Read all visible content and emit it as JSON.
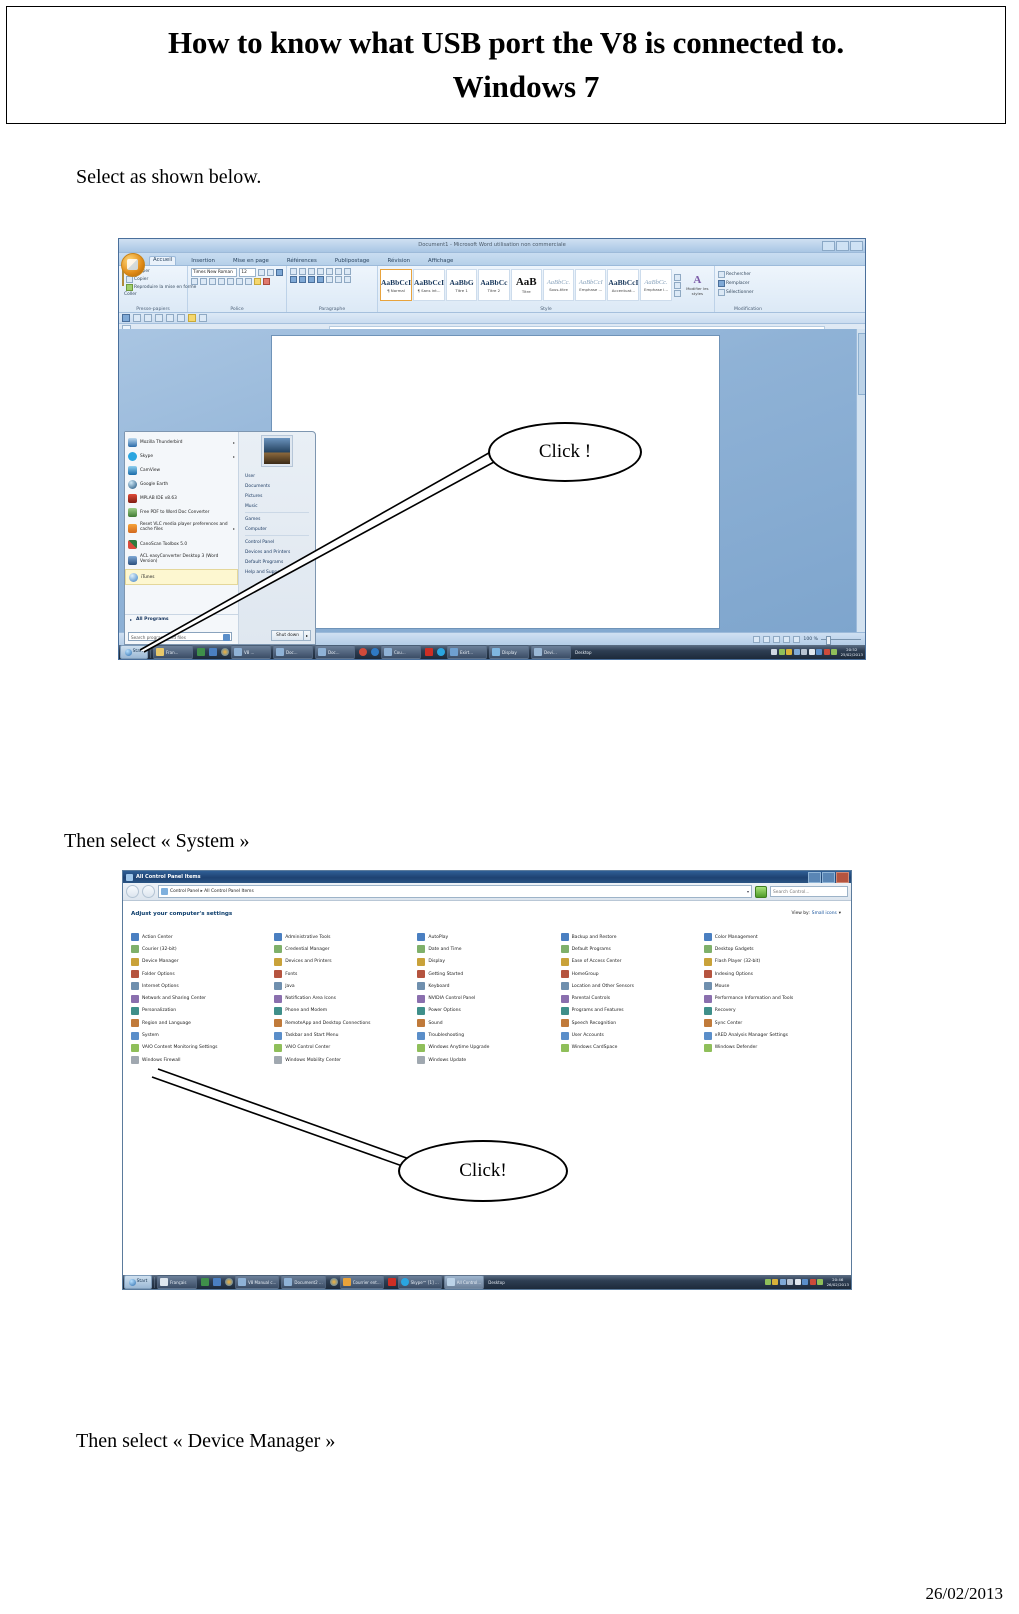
{
  "document": {
    "title_line1": "How to know what USB port the V8 is connected to.",
    "title_line2": "Windows 7",
    "caption_select": "Select as shown below.",
    "caption_system": "Then select « System »",
    "caption_devmgr": "Then select « Device Manager »",
    "footer_date": "26/02/2013"
  },
  "callouts": {
    "first": "Click !",
    "second": "Click!"
  },
  "word_screenshot": {
    "window_title": "Document1  -  Microsoft Word utilisation non commerciale",
    "tabs": [
      "Accueil",
      "Insertion",
      "Mise en page",
      "Références",
      "Publipostage",
      "Révision",
      "Affichage"
    ],
    "active_tab": "Accueil",
    "groups": {
      "clipboard": {
        "label": "Presse-papiers",
        "paste": "Coller",
        "cut": "Couper",
        "copy": "Copier",
        "format_painter": "Reproduire la mise en forme"
      },
      "font": {
        "label": "Police",
        "font_name": "Times New Roman",
        "font_size": "12"
      },
      "paragraph": {
        "label": "Paragraphe"
      },
      "styles": {
        "label": "Style",
        "items": [
          {
            "sample": "AaBbCcI",
            "name": "¶ Normal"
          },
          {
            "sample": "AaBbCcI",
            "name": "¶ Sans int..."
          },
          {
            "sample": "AaBbG",
            "name": "Titre 1"
          },
          {
            "sample": "AaBbCc",
            "name": "Titre 2"
          },
          {
            "sample": "AaB",
            "name": "Titre"
          },
          {
            "sample": "AaBbCc.",
            "name": "Sous-titre"
          },
          {
            "sample": "AaBbCcI",
            "name": "Emphase ..."
          },
          {
            "sample": "AaBbCcI",
            "name": "Accentuat..."
          },
          {
            "sample": "AaBbCc.",
            "name": "Emphase i..."
          }
        ],
        "change_styles": "Modifier les styles"
      },
      "editing": {
        "label": "Modification",
        "find": "Rechercher",
        "replace": "Remplacer",
        "select": "Sélectionner"
      }
    },
    "status_zoom": "100 %",
    "start_menu": {
      "programs": [
        {
          "label": "Mozilla Thunderbird",
          "submenu": true
        },
        {
          "label": "Skype",
          "submenu": true
        },
        {
          "label": "CamView",
          "submenu": false
        },
        {
          "label": "Google Earth",
          "submenu": false
        },
        {
          "label": "MPLAB IDE v8.63",
          "submenu": false
        },
        {
          "label": "Free PDF to Word Doc Converter",
          "submenu": false
        },
        {
          "label": "Reset VLC media player preferences and cache files",
          "submenu": true
        },
        {
          "label": "CanoScan Toolbox 5.0",
          "submenu": false
        },
        {
          "label": "ACL easyConverter Desktop 3 (Word Version)",
          "submenu": false
        },
        {
          "label": "iTunes",
          "submenu": false,
          "selected": true
        }
      ],
      "all_programs": "All Programs",
      "search_placeholder": "Search programs and files",
      "shutdown": "Shut down",
      "right_items": [
        "User",
        "Documents",
        "Pictures",
        "Music",
        "Games",
        "Computer",
        "Control Panel",
        "Devices and Printers",
        "Default Programs",
        "Help and Support"
      ]
    },
    "taskbar": {
      "start": "Start",
      "buttons": [
        "Fran...",
        "",
        "",
        "V8 ...",
        "Doc...",
        "Doc...",
        "Cou...",
        "",
        "Sky...",
        "Exirt...",
        "Display",
        "Devi..."
      ],
      "desktop": "Desktop",
      "clock_time": "20:52",
      "clock_date": "25/02/2013"
    }
  },
  "control_panel_screenshot": {
    "window_title": "All Control Panel Items",
    "breadcrumb": "Control Panel  ▸  All Control Panel Items",
    "search_placeholder": "Search Control...",
    "heading": "Adjust your computer's settings",
    "view_by_label": "View by:",
    "view_by_value": "Small icons",
    "items": [
      "Action Center",
      "Courier (32-bit)",
      "Device Manager",
      "Folder Options",
      "Internet Options",
      "Network and Sharing Center",
      "Personalization",
      "Region and Language",
      "System",
      "VAIO Content Monitoring Settings",
      "Windows Firewall",
      "Administrative Tools",
      "Credential Manager",
      "Devices and Printers",
      "Fonts",
      "Java",
      "Notification Area Icons",
      "Phone and Modem",
      "RemoteApp and Desktop Connections",
      "Taskbar and Start Menu",
      "VAIO Control Center",
      "Windows Mobility Center",
      "AutoPlay",
      "Date and Time",
      "Display",
      "Getting Started",
      "Keyboard",
      "NVIDIA Control Panel",
      "Power Options",
      "Sound",
      "Troubleshooting",
      "Windows Anytime Upgrade",
      "Windows Update",
      "Backup and Restore",
      "Default Programs",
      "Ease of Access Center",
      "HomeGroup",
      "Location and Other Sensors",
      "Parental Controls",
      "Programs and Features",
      "Speech Recognition",
      "User Accounts",
      "Windows CardSpace",
      "",
      "Color Management",
      "Desktop Gadgets",
      "Flash Player (32-bit)",
      "Indexing Options",
      "Mouse",
      "Performance Information and Tools",
      "Recovery",
      "Sync Center",
      "xRED Analysis Manager Settings",
      "Windows Defender",
      ""
    ],
    "taskbar": {
      "start": "Start",
      "buttons": [
        "Français",
        "",
        "",
        "",
        "V8 Manual c...",
        "Document2 ...",
        "",
        "Courrier ent...",
        "",
        "Skype™ [1] ...",
        "All Control..."
      ],
      "desktop": "Desktop",
      "clock_time": "20:46",
      "clock_date": "26/02/2013"
    }
  }
}
